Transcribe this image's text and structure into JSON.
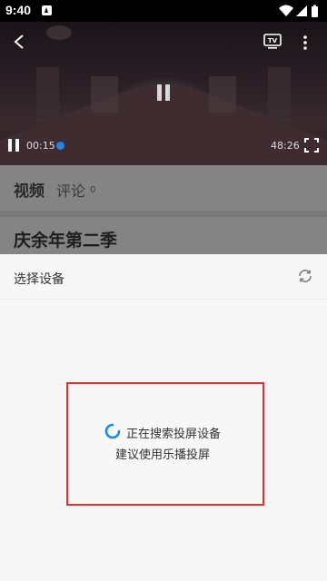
{
  "status_bar": {
    "time": "9:40"
  },
  "player": {
    "current_time": "00:15",
    "duration": "48:26",
    "progress_fraction": 0.005
  },
  "tabs": {
    "video": "视频",
    "comment": "评论",
    "comment_count": "0"
  },
  "show": {
    "title": "庆余年第二季"
  },
  "device_sheet": {
    "title": "选择设备",
    "searching_text": "正在搜索投屏设备",
    "suggestion_text": "建议使用乐播投屏"
  },
  "colors": {
    "accent_blue": "#1e88e5",
    "highlight_red": "#e0302f"
  }
}
